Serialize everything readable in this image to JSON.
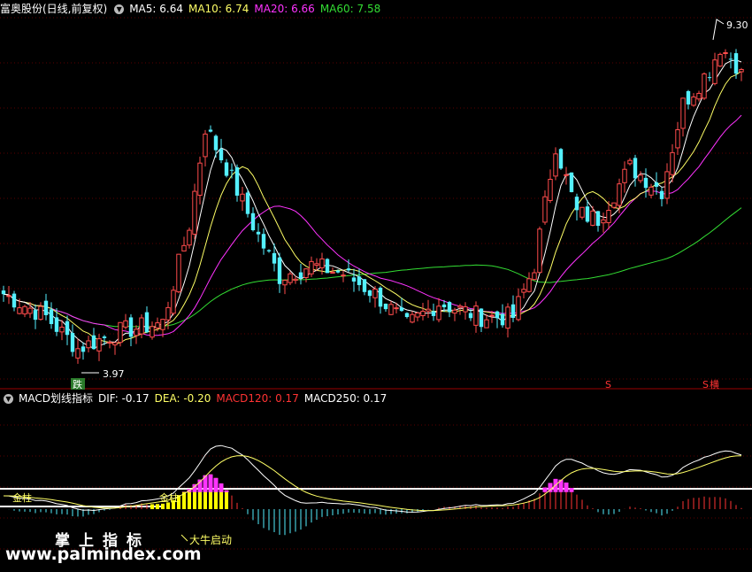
{
  "price_header": {
    "stock": "富奥股份(日线,前复权)",
    "ma5": "MA5: 6.64",
    "ma10": "MA10: 6.74",
    "ma20": "MA20: 6.66",
    "ma60": "MA60: 7.58"
  },
  "macd_header": {
    "name": "MACD划线指标",
    "dif": "DIF: -0.17",
    "dea": "DEA: -0.20",
    "macd120": "MACD120: 0.17",
    "macd250": "MACD250: 0.17"
  },
  "annotations": {
    "high_label": "9.30",
    "low_label": "3.97",
    "die_label": "跌",
    "s_label": "S",
    "s_label2": "S",
    "hui_label": "横",
    "golden_cross1": "金柱",
    "golden_cross2": "金柱",
    "bull_start": "大牛启动"
  },
  "watermark": {
    "line1": "掌上指标",
    "line2": "www.palmindex.com"
  },
  "colors": {
    "up": "#ff4c4c",
    "down": "#54f0ff",
    "ma5": "#ffffff",
    "ma10": "#ffff66",
    "ma20": "#ff33ff",
    "ma60": "#33dd33",
    "macd_hist_pos": "#ff3333",
    "macd_hist_neg": "#54f0ff",
    "macd_hist_bull": "#ffff00",
    "macd_hist_magenta": "#ff33ff"
  },
  "chart_data": [
    {
      "type": "candlestick",
      "x": "trading days (approx. 140 bars)",
      "anchors": [
        {
          "i": 0,
          "close": 5.0
        },
        {
          "i": 8,
          "close": 4.6
        },
        {
          "i": 14,
          "close": 4.05
        },
        {
          "i": 22,
          "close": 4.35
        },
        {
          "i": 30,
          "close": 4.5
        },
        {
          "i": 35,
          "close": 6.2
        },
        {
          "i": 38,
          "close": 7.9
        },
        {
          "i": 42,
          "close": 7.2
        },
        {
          "i": 48,
          "close": 6.0
        },
        {
          "i": 52,
          "close": 5.3
        },
        {
          "i": 58,
          "close": 5.5
        },
        {
          "i": 64,
          "close": 5.35
        },
        {
          "i": 70,
          "close": 5.0
        },
        {
          "i": 76,
          "close": 4.45
        },
        {
          "i": 82,
          "close": 4.85
        },
        {
          "i": 90,
          "close": 4.6
        },
        {
          "i": 96,
          "close": 4.6
        },
        {
          "i": 100,
          "close": 5.5
        },
        {
          "i": 104,
          "close": 7.6
        },
        {
          "i": 108,
          "close": 6.4
        },
        {
          "i": 112,
          "close": 6.3
        },
        {
          "i": 118,
          "close": 7.2
        },
        {
          "i": 124,
          "close": 6.8
        },
        {
          "i": 128,
          "close": 8.3
        },
        {
          "i": 133,
          "close": 8.9
        },
        {
          "i": 135,
          "close": 9.3
        },
        {
          "i": 139,
          "close": 8.9
        }
      ],
      "marked_high": 9.3,
      "marked_low": 3.97,
      "ma_series": [
        "MA5",
        "MA10",
        "MA20",
        "MA60"
      ],
      "ma_last": {
        "MA5": 6.64,
        "MA10": 6.74,
        "MA20": 6.66,
        "MA60": 7.58
      }
    },
    {
      "type": "bar+line",
      "title": "MACD划线指标",
      "series": [
        {
          "name": "DIF",
          "last": -0.17
        },
        {
          "name": "DEA",
          "last": -0.2
        },
        {
          "name": "MACD120",
          "last": 0.17
        },
        {
          "name": "MACD250",
          "last": 0.17
        }
      ]
    }
  ]
}
